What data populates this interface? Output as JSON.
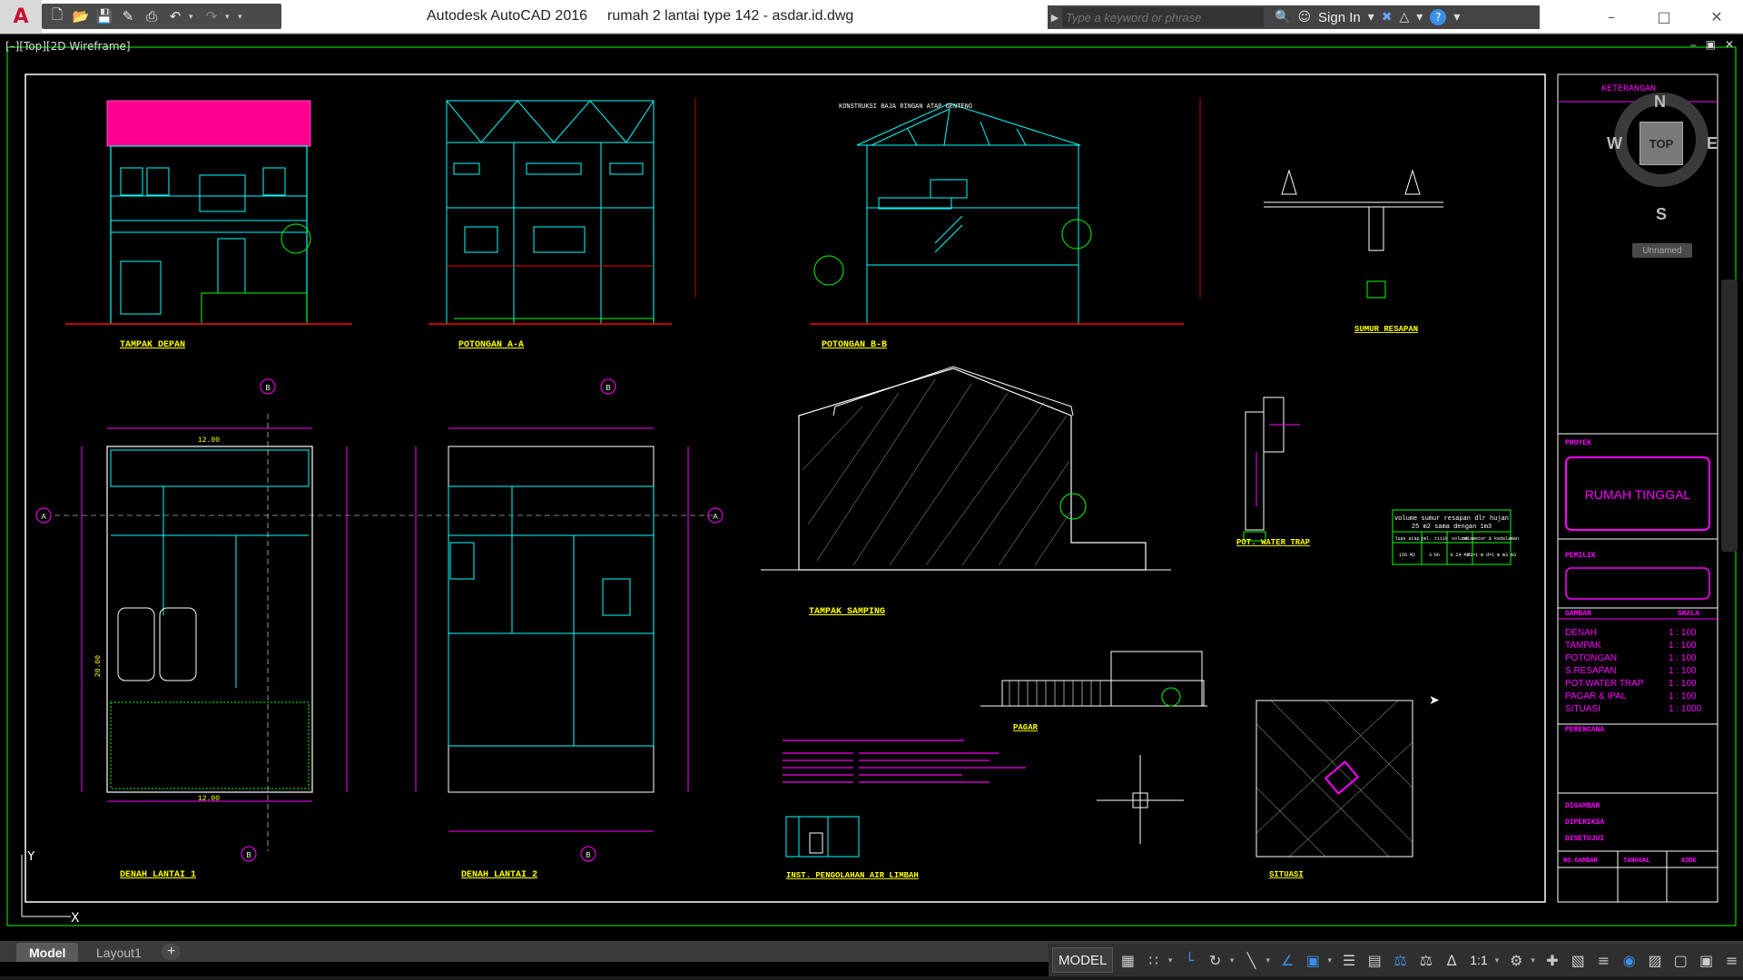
{
  "titlebar": {
    "app_name": "Autodesk AutoCAD 2016",
    "file_name": "rumah 2 lantai type 142 - asdar.id.dwg",
    "search_placeholder": "Type a keyword or phrase",
    "sign_in": "Sign In",
    "help": "?"
  },
  "viewport": {
    "label": "[–][Top][2D Wireframe]",
    "ctrl_min": "–",
    "ctrl_restore": "▣",
    "ctrl_close": "✕"
  },
  "viewcube": {
    "top": "TOP",
    "n": "N",
    "s": "S",
    "e": "E",
    "w": "W",
    "ucs_name": "Unnamed"
  },
  "ucs": {
    "y": "Y",
    "x": "X"
  },
  "drawing": {
    "views": {
      "tampak_depan": "TAMPAK DEPAN",
      "potongan_aa": "POTONGAN A-A",
      "potongan_bb": "POTONGAN B-B",
      "sumur_resapan": "SUMUR RESAPAN",
      "denah_1": "DENAH LANTAI 1",
      "denah_2": "DENAH LANTAI 2",
      "tampak_samping": "TAMPAK SAMPING",
      "pot_water_trap": "POT. WATER TRAP",
      "pagar": "PAGAR",
      "inst_limbah": "INST. PENGOLAHAN AIR LIMBAH",
      "situasi": "SITUASI"
    },
    "roof_note": "KONSTRUKSI BAJA RINGAN ATAP GENTENG",
    "table": {
      "header": "volume sumur resapan dlr hujan",
      "header2": "25 m2 sama dengan 1m3",
      "cols": [
        "luas atap",
        "jml. titik",
        "volume",
        "diameter & kedalaman"
      ],
      "row": [
        "156 M2",
        "3 bh",
        "6.24 M3",
        "d1=1 m d=1 m m3 m3"
      ]
    },
    "dims": {
      "depth": "12.00",
      "length": "20.00"
    },
    "grid_labels": {
      "a": "A",
      "b": "B"
    }
  },
  "title_block": {
    "keterangan": "KETERANGAN",
    "proyek": "PROYEK",
    "project_name": "RUMAH TINGGAL",
    "pemilik": "PEMILIK",
    "gambar": "GAMBAR",
    "skala": "SKALA",
    "drawings": [
      {
        "name": "DENAH",
        "scale": "1 : 100"
      },
      {
        "name": "TAMPAK",
        "scale": "1 : 100"
      },
      {
        "name": "POTONGAN",
        "scale": "1 : 100"
      },
      {
        "name": "S.RESAPAN",
        "scale": "1 : 100"
      },
      {
        "name": "POT.WATER TRAP",
        "scale": "1 : 100"
      },
      {
        "name": "PAGAR & IPAL",
        "scale": "1 : 100"
      },
      {
        "name": "SITUASI",
        "scale": "1 : 1000"
      }
    ],
    "perencana": "PERENCANA",
    "digambar": "DIGAMBAR",
    "diperiksa": "DIPERIKSA",
    "disetujui": "DISETUJUI",
    "no_gambar": "NO.GAMBAR",
    "tanggal": "TANGGAL",
    "kode": "KODE"
  },
  "tabs": {
    "model": "Model",
    "layout1": "Layout1",
    "add": "+"
  },
  "status": {
    "model": "MODEL",
    "scale": "1:1"
  }
}
